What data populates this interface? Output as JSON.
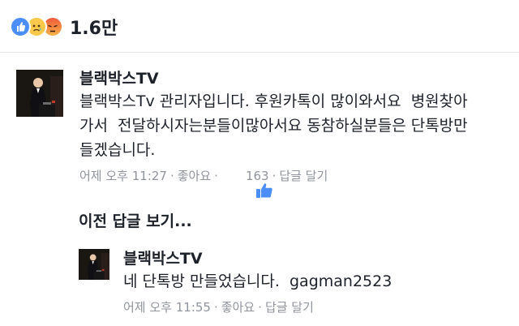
{
  "reactions": {
    "count": "1.6만",
    "icons": [
      "like-icon",
      "sad-icon",
      "angry-icon"
    ]
  },
  "comment1": {
    "author": "블랙박스TV",
    "lines": [
      "블랙박스Tv 관리자입니다. 후원카톡이 많이와서요  병원찾아",
      "가서  전달하시자는분들이많아서요 동참하실분들은 단톡방만",
      "들겠습니다."
    ],
    "time": "어제 오후 11:27",
    "like_label": "좋아요",
    "like_count": "163",
    "reply_label": "답글 달기"
  },
  "view_previous": "이전 답글 보기...",
  "comment2": {
    "author": "블랙박스TV",
    "text": "네 단톡방 만들었습니다.  gagman2523",
    "time": "어제 오후 11:55",
    "like_label": "좋아요",
    "reply_label": "답글 달기"
  },
  "colors": {
    "accent": "#4c8ef7",
    "meta_text": "#90949c",
    "divider": "#e5e6ea"
  }
}
